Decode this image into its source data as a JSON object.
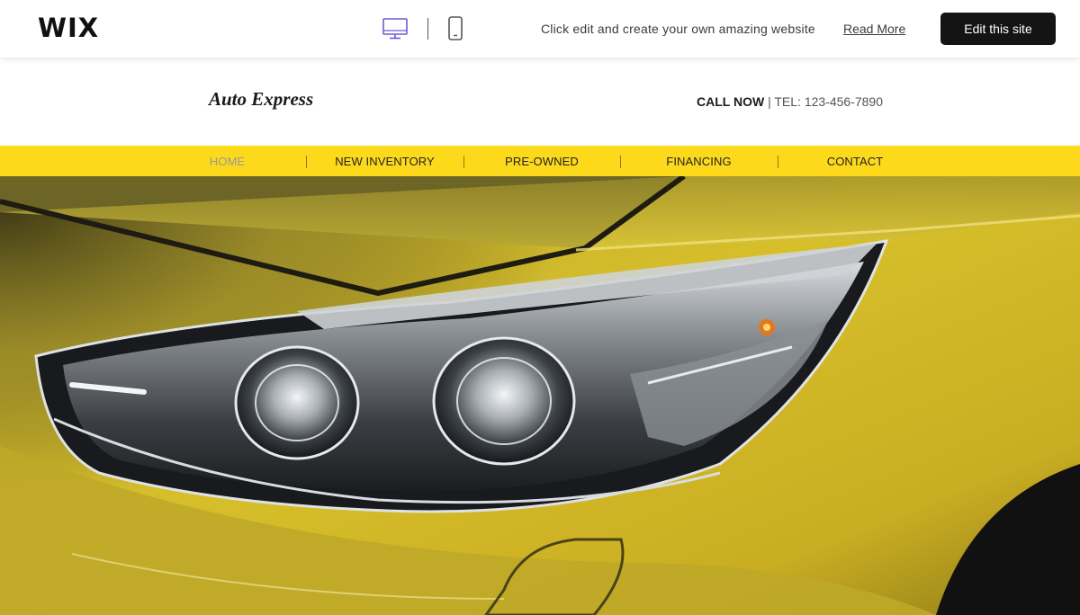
{
  "wix_bar": {
    "logo": "WIX",
    "promo_text": "Click edit and create your own amazing website",
    "read_more_label": "Read More",
    "edit_button_label": "Edit this site",
    "icons": [
      "desktop-icon",
      "mobile-icon"
    ]
  },
  "site": {
    "logo": "Auto Express",
    "call_now": "CALL NOW",
    "separator": "|",
    "phone": "TEL: 123-456-7890"
  },
  "nav": {
    "items": [
      {
        "label": "HOME",
        "active": true
      },
      {
        "label": "NEW INVENTORY",
        "active": false
      },
      {
        "label": "PRE-OWNED",
        "active": false
      },
      {
        "label": "FINANCING",
        "active": false
      },
      {
        "label": "CONTACT",
        "active": false
      }
    ]
  },
  "hero": {
    "image": "yellow-car-headlight-photo"
  },
  "colors": {
    "nav_background": "#fdd91c",
    "edit_button": "#141414",
    "desktop_icon_accent": "#6c5bd4"
  }
}
